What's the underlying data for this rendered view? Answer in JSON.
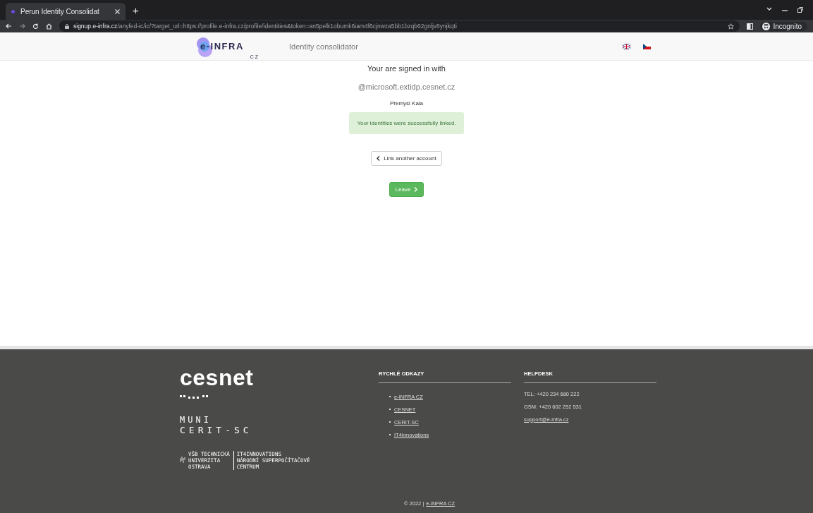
{
  "browser": {
    "tab_title": "Perun Identity Consolidat",
    "new_tab": "+",
    "url_host": "signup.e-infra.cz",
    "url_path": "/anyfed-ic/ic/?target_url=https://profile.e-infra.cz/profile/identities&token=an5pelk1obumk6iam4f6cjnwza5bb1bzqb62gnljv8ynjkqti",
    "profile": "Incognito"
  },
  "navbar": {
    "logo_text": "e-INFRA",
    "logo_sub": "CZ",
    "title": "Identity consolidator",
    "languages": [
      {
        "kind": "en"
      },
      {
        "kind": "cs"
      }
    ]
  },
  "main": {
    "heading": "Your are signed in with",
    "identity": "@microsoft.extidp.cesnet.cz",
    "name": "Přemysl Kala",
    "alert": "Your identities were successfully linked.",
    "link_button": "Link another account",
    "leave_button": "Leave"
  },
  "footer": {
    "logos": {
      "cesnet": "cesnet",
      "muni": "MUNI",
      "cerit": "CERIT-SC",
      "vsb": [
        "VŠB TECHNICKÁ",
        "UNIVERZITA",
        "OSTRAVA"
      ],
      "it4i": [
        "IT4INNOVATIONS",
        "NÁRODNÍ SUPERPOČÍTAČOVÉ",
        "CENTRUM"
      ]
    },
    "links_title": "RYCHLÉ ODKAZY",
    "links": [
      "e-INFRA CZ",
      "CESNET",
      "CERIT-SC",
      "IT4Innovations"
    ],
    "helpdesk_title": "HELPDESK",
    "helpdesk": [
      {
        "kind": "text",
        "text": "TEL: +420 234 680 222"
      },
      {
        "kind": "text",
        "text": "GSM: +420 602 252 531"
      },
      {
        "kind": "link",
        "text": "support@e-infra.cz"
      }
    ],
    "copyright": "© 2022 |",
    "copyright_link": "e-INFRA CZ"
  }
}
